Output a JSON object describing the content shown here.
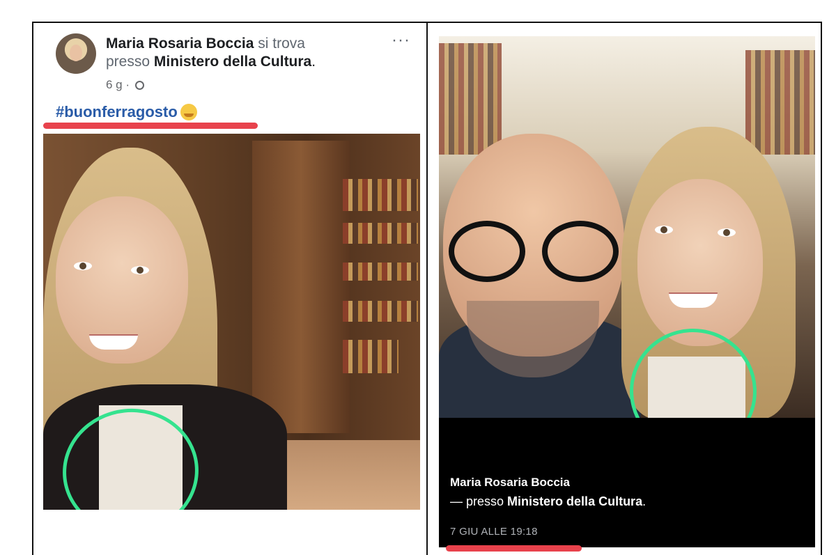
{
  "left_post": {
    "author": "Maria Rosaria Boccia",
    "location_verb": "si trova",
    "location_prefix": "presso",
    "location": "Ministero della Cultura",
    "location_suffix": ".",
    "time": "6 g",
    "separator": "·",
    "more_label": "···",
    "hashtag": "#buonferragosto"
  },
  "right_post": {
    "author": "Maria Rosaria Boccia",
    "location_prefix": "— presso",
    "location": "Ministero della Cultura",
    "location_suffix": ".",
    "date": "7 GIU ALLE 19:18"
  },
  "colors": {
    "underline": "#e8424c",
    "highlight_circle": "#35e38f",
    "hashtag": "#2a5ca8"
  },
  "icons": [
    "globe-icon",
    "more-options-icon",
    "smiling-emoji-icon"
  ]
}
